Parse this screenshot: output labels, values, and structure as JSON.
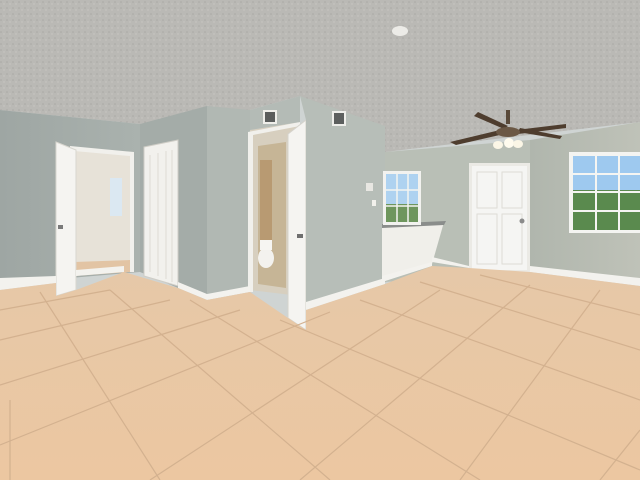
{
  "scene": {
    "description_kind": "photo",
    "elements": [
      "textured-ceiling",
      "ceiling-fan",
      "left-open-door",
      "bifold-closet-door",
      "bathroom-doorway",
      "front-entry-door",
      "kitchen-counter-half-wall",
      "left-window",
      "right-window",
      "tile-floor",
      "smoke-detector",
      "hvac-vents"
    ]
  },
  "colors": {
    "ceiling": "#b9b8b4",
    "wall_left": "#a9b1ad",
    "wall_mid": "#b3bab5",
    "wall_right": "#b8bcb2",
    "trim": "#f3f2ee",
    "floor": "#eac8a6",
    "floor_grout": "#d2ad8b",
    "door": "#f4f4f2",
    "window_sky": "#a8cdf0",
    "window_tree": "#5c8a50"
  }
}
